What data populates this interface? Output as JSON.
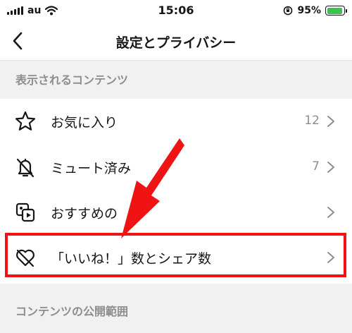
{
  "status_bar": {
    "carrier": "au",
    "time": "15:06",
    "battery_percent": "95%",
    "battery_level": 0.95
  },
  "nav": {
    "title": "設定とプライバシー"
  },
  "section_displayed": {
    "title": "表示されるコンテンツ",
    "rows": [
      {
        "label": "お気に入り",
        "count": "12",
        "icon": "star-icon"
      },
      {
        "label": "ミュート済み",
        "count": "7",
        "icon": "bell-slash-icon"
      },
      {
        "label": "おすすめの",
        "count": "",
        "icon": "suggested-content-icon"
      },
      {
        "label": "「いいね！」数とシェア数",
        "count": "",
        "icon": "heart-slash-icon"
      }
    ]
  },
  "section_next": {
    "title": "コンテンツの公開範囲"
  },
  "colors": {
    "highlight": "#ef1313",
    "battery_fill": "#39c54b"
  }
}
